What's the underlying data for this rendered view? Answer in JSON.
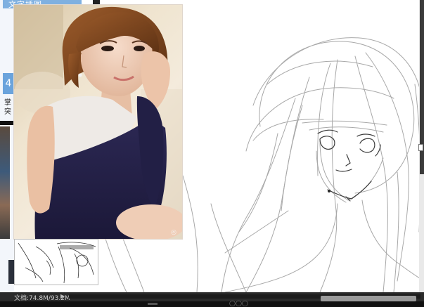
{
  "window": {
    "app": "drawing canvas with reference image"
  },
  "left_page": {
    "banner_text": "文字插图",
    "tab_label": "4",
    "side_text": "掌 突"
  },
  "reference_photo": {
    "watermark": "◎"
  },
  "status_bar": {
    "doc_info": "文档:74.8M/93.2M",
    "arrow_right": "▶",
    "arrow_small": "▸"
  },
  "footer": {
    "text": "◯◯◯"
  },
  "colors": {
    "banner_blue": "#7fb0e0",
    "sketch_gray": "#9a9a9a",
    "status_bg": "#2a2a2a",
    "dress_navy": "#23204a",
    "hair_brown": "#7a4420"
  }
}
